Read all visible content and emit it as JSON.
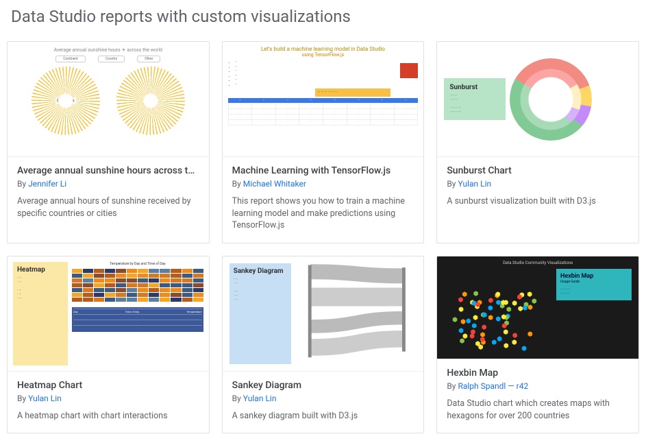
{
  "page": {
    "title": "Data Studio reports with custom visualizations"
  },
  "cards": [
    {
      "title": "Average annual sunshine hours across th…",
      "by_prefix": "By ",
      "author": "Jennifer Li",
      "desc": "Average annual hours of sunshine received by specific countries or cities",
      "thumb": {
        "header": "Average annual sunshine hours ☀ across the world",
        "chips": [
          "Continent",
          "Country",
          "Other"
        ],
        "labels": [
          "Countries",
          "Cities"
        ]
      }
    },
    {
      "title": "Machine Learning with TensorFlow.js",
      "by_prefix": "By ",
      "author": "Michael Whitaker",
      "desc": "This report shows you how to train a machine learning model and make predictions using TensorFlow.js",
      "thumb": {
        "line1": "Let's build a machine learning model in Data Studio",
        "line2": "using TensorFlow.js"
      }
    },
    {
      "title": "Sunburst Chart",
      "by_prefix": "By ",
      "author": "Yulan Lin",
      "desc": "A sunburst visualization built with D3.js",
      "thumb": {
        "panel_title": "Sunburst"
      }
    },
    {
      "title": "Heatmap Chart",
      "by_prefix": "By ",
      "author": "Yulan Lin",
      "desc": "A heatmap chart with chart interactions",
      "thumb": {
        "panel_title": "Heatmap",
        "caption": "Temperature by Day and Time of Day"
      }
    },
    {
      "title": "Sankey Diagram",
      "by_prefix": "By ",
      "author": "Yulan Lin",
      "desc": "A sankey diagram built with D3.js",
      "thumb": {
        "panel_title": "Sankey Diagram"
      }
    },
    {
      "title": "Hexbin Map",
      "by_prefix": "By ",
      "author": "Ralph Spandl — r42",
      "desc": "Data Studio chart which creates maps with hexagons for over 200 countries",
      "thumb": {
        "top": "Data Studio Community Visualizations",
        "panel_title": "Hexbin Map",
        "panel_sub": "Usage Guide"
      }
    }
  ]
}
